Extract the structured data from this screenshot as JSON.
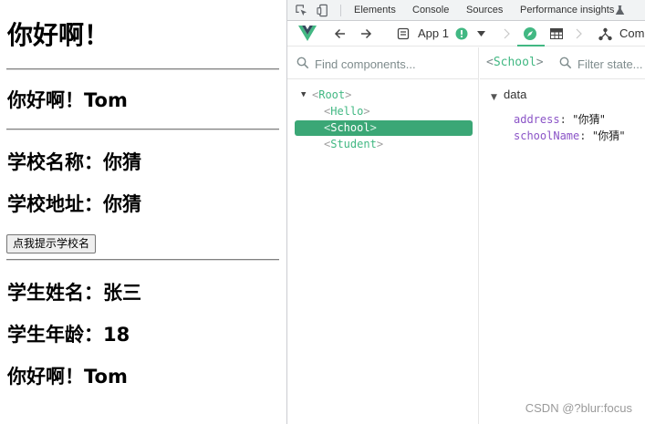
{
  "page": {
    "title": "你好啊！",
    "hello_text": "你好啊！Tom",
    "school_name": "学校名称：你猜",
    "school_address": "学校地址：你猜",
    "button_label": "点我提示学校名",
    "student_name": "学生姓名：张三",
    "student_age": "学生年龄：18",
    "student_hello": "你好啊！Tom"
  },
  "devtools": {
    "tabs": [
      "Elements",
      "Console",
      "Sources",
      "Performance insights"
    ],
    "vue_toolbar": {
      "app_label": "App 1",
      "components_label": "Comp"
    },
    "tree": {
      "search_placeholder": "Find components...",
      "items": [
        {
          "name": "Root",
          "open": "<",
          "close": ">"
        },
        {
          "name": "Hello",
          "open": "<",
          "close": ">"
        },
        {
          "name": "School",
          "open": "<",
          "close": ">"
        },
        {
          "name": "Student",
          "open": "<",
          "close": ">"
        }
      ],
      "selected_index": 2
    },
    "inspector": {
      "selected": {
        "name": "School",
        "open": "<",
        "close": ">"
      },
      "filter_placeholder": "Filter state...",
      "section": "data",
      "props": [
        {
          "key": "address",
          "colon": ":",
          "value": "\"你猜\""
        },
        {
          "key": "schoolName",
          "colon": ":",
          "value": "\"你猜\""
        }
      ]
    }
  },
  "watermark": "CSDN @?blur:focus",
  "colors": {
    "vue_green": "#42b883",
    "selection": "#3ba776",
    "prop_key": "#8b54c7"
  },
  "icons": [
    "inspect-icon",
    "device-icon",
    "experiment-icon",
    "vue-logo-icon",
    "back-icon",
    "forward-icon",
    "app-icon",
    "status-icon",
    "dropdown-icon",
    "breadcrumb-chevron-icon",
    "components-icon",
    "timeline-icon",
    "component-tree-icon",
    "search-icon"
  ]
}
